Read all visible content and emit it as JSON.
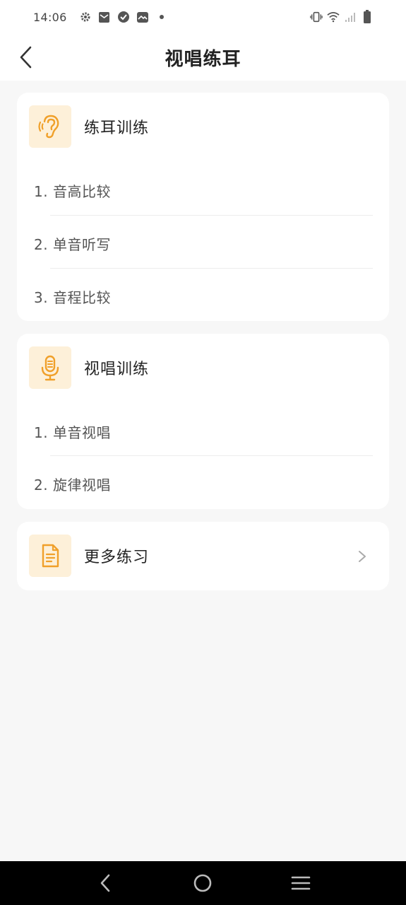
{
  "status_bar": {
    "time": "14:06",
    "left_icons": [
      "gear-icon",
      "mail-icon",
      "check-circle-icon",
      "photo-icon",
      "dot-icon"
    ],
    "right_icons": [
      "vibrate-icon",
      "wifi-icon",
      "signal-icon",
      "battery-icon"
    ]
  },
  "header": {
    "title": "视唱练耳",
    "back_icon": "chevron-left-icon"
  },
  "ear_training": {
    "icon": "ear-icon",
    "title": "练耳训练",
    "items": [
      "1. 音高比较",
      "2. 单音听写",
      "3. 音程比较"
    ]
  },
  "sight_singing": {
    "icon": "microphone-icon",
    "title": "视唱训练",
    "items": [
      "1. 单音视唱",
      "2. 旋律视唱"
    ]
  },
  "more": {
    "icon": "document-icon",
    "title": "更多练习",
    "chevron": "chevron-right-icon"
  },
  "nav_bar": {
    "buttons": [
      "back-icon",
      "home-icon",
      "menu-icon"
    ]
  },
  "colors": {
    "accent": "#f0a02a",
    "icon_tile_bg": "#fdf0d9",
    "page_bg": "#f7f7f7",
    "card_bg": "#ffffff"
  }
}
